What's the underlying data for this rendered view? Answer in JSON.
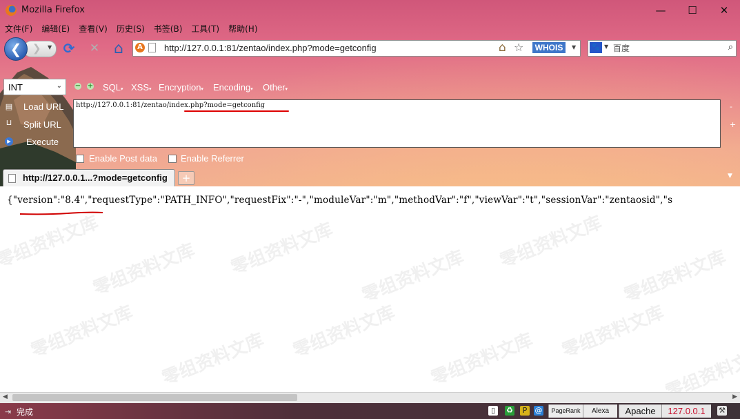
{
  "window": {
    "title": "Mozilla Firefox",
    "minimize": "—",
    "maximize": "☐",
    "close": "✕"
  },
  "menu": [
    "文件(F)",
    "编辑(E)",
    "查看(V)",
    "历史(S)",
    "书签(B)",
    "工具(T)",
    "帮助(H)"
  ],
  "nav": {
    "back": "❮",
    "forward": "❯",
    "forward_drop": "▼",
    "reload": "⟳",
    "stop": "✕",
    "home": "⌂",
    "url_site_icon": "A",
    "url": "http://127.0.0.1:81/zentao/index.php?mode=getconfig",
    "whois": "WHOIS",
    "search_drop": "▼",
    "search_engine_icon": "🐾",
    "search_placeholder": "百度",
    "search_go": "⌕",
    "home_icon_right": "⌂",
    "star": "☆"
  },
  "hackbar": {
    "select_value": "INT",
    "select_chevron": "⌄",
    "minus": "−",
    "plus": "+",
    "menus": [
      "SQL",
      "XSS",
      "Encryption",
      "Encoding",
      "Other"
    ],
    "menu_arrow": "▾",
    "load_url": "Load URL",
    "split_url": "Split URL",
    "execute": "Execute",
    "textarea_value": "http://127.0.0.1:81/zentao/index.php?mode=getconfig",
    "side_minus": "-",
    "side_plus": "+",
    "enable_post": "Enable Post data",
    "enable_referrer": "Enable Referrer"
  },
  "tabs": {
    "active_title": "http://127.0.0.1...?mode=getconfig",
    "new_tab": "+",
    "list_drop": "▼"
  },
  "content": {
    "json_line": "{\"version\":\"8.4\",\"requestType\":\"PATH_INFO\",\"requestFix\":\"-\",\"moduleVar\":\"m\",\"methodVar\":\"f\",\"viewVar\":\"t\",\"sessionVar\":\"zentaosid\",\"s"
  },
  "watermark": "零组资料文库",
  "scroll": {
    "left": "◀",
    "right": "▶"
  },
  "status": {
    "icon": "⇥",
    "text": "完成",
    "pagerank": "PageRank",
    "alexa": "Alexa",
    "server": "Apache",
    "ip": "127.0.0.1"
  },
  "colors": {
    "accent_red": "#d00000",
    "whois_blue": "#3f77c9",
    "ip_red": "#c8102e"
  }
}
